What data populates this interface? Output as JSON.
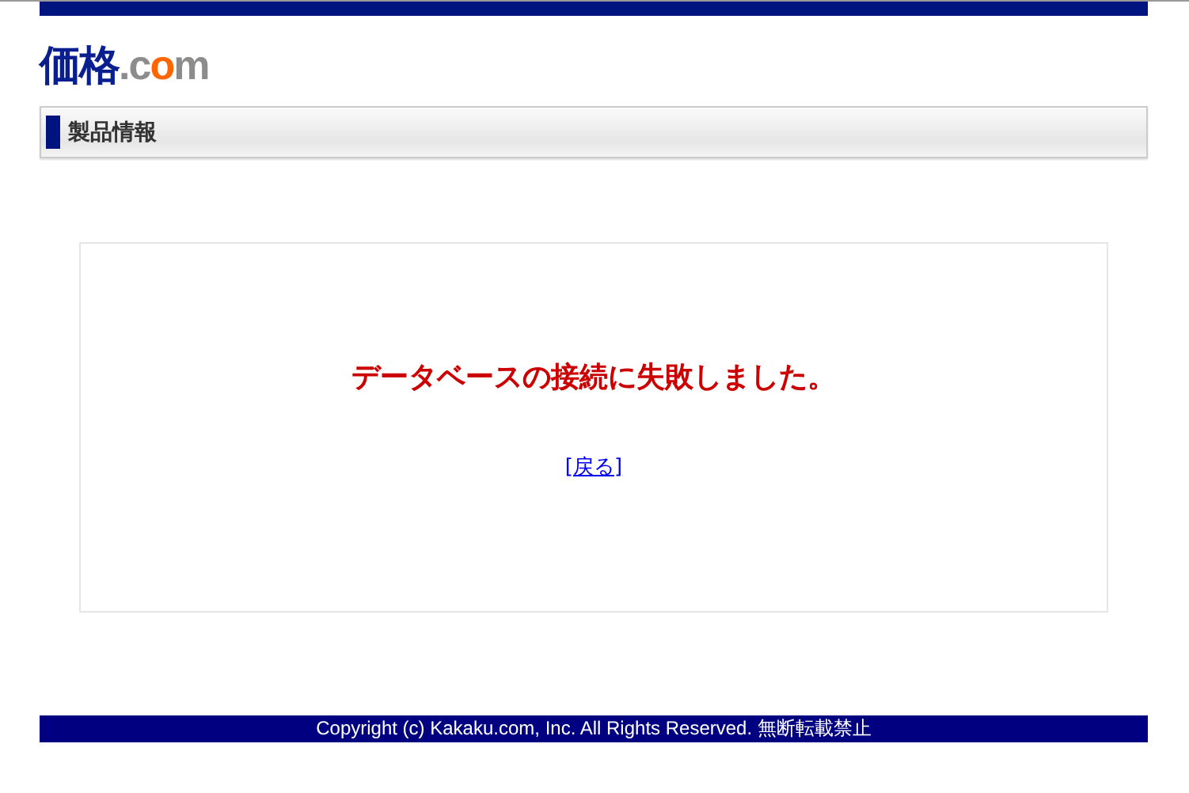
{
  "logo": {
    "parts": [
      {
        "text": "価格",
        "color": "#0a1f8f"
      },
      {
        "text": ".c",
        "color": "#8c8c8c"
      },
      {
        "text": "o",
        "color": "#ff6600"
      },
      {
        "text": "m",
        "color": "#8c8c8c"
      }
    ]
  },
  "section_heading": "製品情報",
  "error": {
    "message": "データベースの接続に失敗しました。",
    "back_link": "[戻る]"
  },
  "footer": "Copyright (c) Kakaku.com, Inc. All Rights Reserved. 無断転載禁止"
}
